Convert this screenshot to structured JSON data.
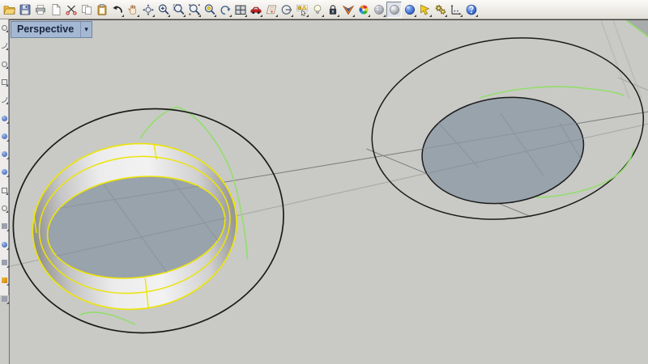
{
  "viewport": {
    "label": "Perspective",
    "dropdown_glyph": "▾"
  },
  "toolbar": {
    "icons": [
      {
        "name": "open-folder",
        "glyph": "folder",
        "flyout": false
      },
      {
        "name": "save",
        "glyph": "floppy",
        "flyout": false
      },
      {
        "name": "print",
        "glyph": "printer",
        "flyout": false
      },
      {
        "name": "document",
        "glyph": "page",
        "flyout": false
      },
      {
        "name": "cut-scissors",
        "glyph": "scissors",
        "flyout": false
      },
      {
        "name": "copy",
        "glyph": "copy",
        "flyout": false
      },
      {
        "name": "paste-clipboard",
        "glyph": "clip",
        "flyout": false
      },
      {
        "name": "undo",
        "glyph": "undo",
        "flyout": true
      },
      {
        "name": "pan-hand",
        "glyph": "hand",
        "flyout": true
      },
      {
        "name": "rotate-view",
        "glyph": "rotate",
        "flyout": true
      },
      {
        "name": "zoom",
        "glyph": "zoomplus",
        "flyout": true
      },
      {
        "name": "zoom-window",
        "glyph": "zoomwin",
        "flyout": true
      },
      {
        "name": "zoom-extents",
        "glyph": "zoomext",
        "flyout": true
      },
      {
        "name": "zoom-selected",
        "glyph": "zoomsel",
        "flyout": true
      },
      {
        "name": "undo-view-change",
        "glyph": "viewundo",
        "flyout": true
      },
      {
        "name": "viewport-layout",
        "glyph": "layout",
        "flyout": true
      },
      {
        "name": "car",
        "glyph": "car",
        "flyout": true
      },
      {
        "name": "map",
        "glyph": "map",
        "flyout": true
      },
      {
        "name": "circle-plane",
        "glyph": "cplane",
        "flyout": true
      },
      {
        "name": "select-objects",
        "glyph": "select",
        "flyout": true
      },
      {
        "name": "lightbulb-visibility",
        "glyph": "bulb",
        "flyout": true
      },
      {
        "name": "lock",
        "glyph": "lock",
        "flyout": true
      },
      {
        "name": "shaded-display",
        "glyph": "shade",
        "flyout": true
      },
      {
        "name": "color-wheel",
        "glyph": "wheel",
        "flyout": true
      },
      {
        "name": "sphere-ghosted",
        "glyph": "sphg",
        "flyout": true
      },
      {
        "name": "sphere-shaded",
        "glyph": "sphs",
        "flyout": false,
        "pressed": true
      },
      {
        "name": "sphere-rendered",
        "glyph": "sphb",
        "flyout": true
      },
      {
        "name": "pointer-flag",
        "glyph": "pointer",
        "flyout": true
      },
      {
        "name": "gears-options",
        "glyph": "gears",
        "flyout": true
      },
      {
        "name": "dimension",
        "glyph": "dim",
        "flyout": true
      },
      {
        "name": "help",
        "glyph": "help",
        "flyout": true
      }
    ]
  },
  "colors": {
    "surface": "#c9cac5",
    "hole_interior": "#99a3ab",
    "selection_yellow": "#ece409",
    "curve_green": "#94dd6e",
    "outline": "#1b1b1b",
    "grid_dark": "#808284",
    "grid_light": "#a7a9a4",
    "grid_interior": "#8b939c",
    "corner_surface": "#a8acab",
    "viewport_label_bg": "#a4b8d4",
    "viewport_label_text": "#18243c"
  }
}
